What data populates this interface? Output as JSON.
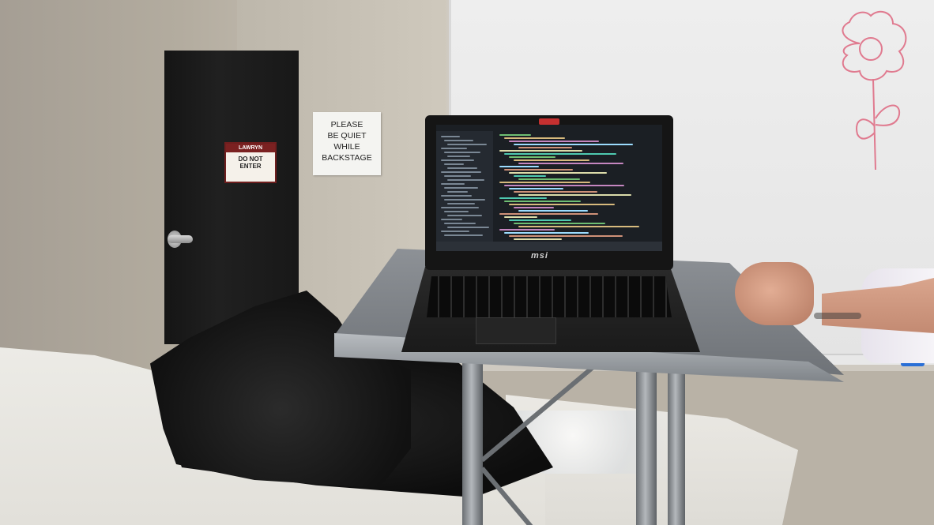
{
  "scene": {
    "door_sign": {
      "brand": "LAWRYN",
      "text": "DO NOT\nENTER"
    },
    "paper_sign": {
      "lines": [
        "PLEASE",
        "BE QUIET",
        "WHILE",
        "BACKSTAGE"
      ]
    },
    "laptop": {
      "brand": "msi"
    }
  },
  "colors": {
    "wall": "#b3ac9f",
    "whiteboard": "#ececec",
    "door": "#1a1a1a",
    "sign_red": "#7b2121",
    "marker_pink": "#e07a8f",
    "screen_bg": "#1b1f24"
  },
  "icons": [
    "door-handle-icon",
    "flower-drawing-icon"
  ]
}
